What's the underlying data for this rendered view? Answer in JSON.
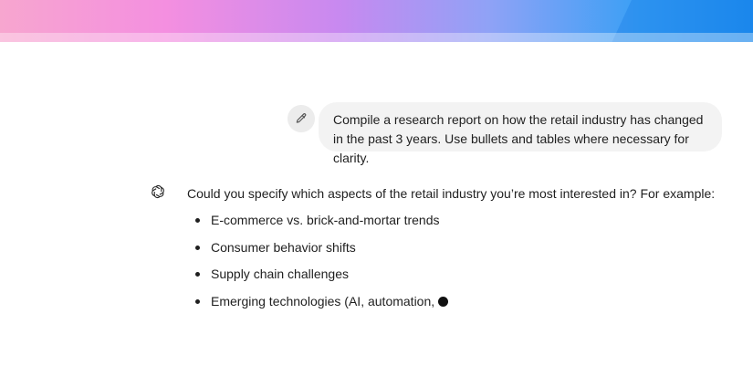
{
  "user_message": {
    "text": "Compile a research report on how the retail industry has changed in the past 3 years. Use bullets and tables where necessary for clarity."
  },
  "assistant_message": {
    "intro": "Could you specify which aspects of the retail industry you’re most interested in? For example:",
    "bullets": [
      "E-commerce vs. brick-and-mortar trends",
      "Consumer behavior shifts",
      "Supply chain challenges",
      "Emerging technologies (AI, automation,"
    ]
  },
  "icons": {
    "edit": "pencil-icon",
    "assistant": "openai-logo-icon",
    "streaming": "typing-cursor-icon"
  },
  "colors": {
    "user_bubble": "#f3f3f3",
    "text": "#1f1f1f"
  }
}
